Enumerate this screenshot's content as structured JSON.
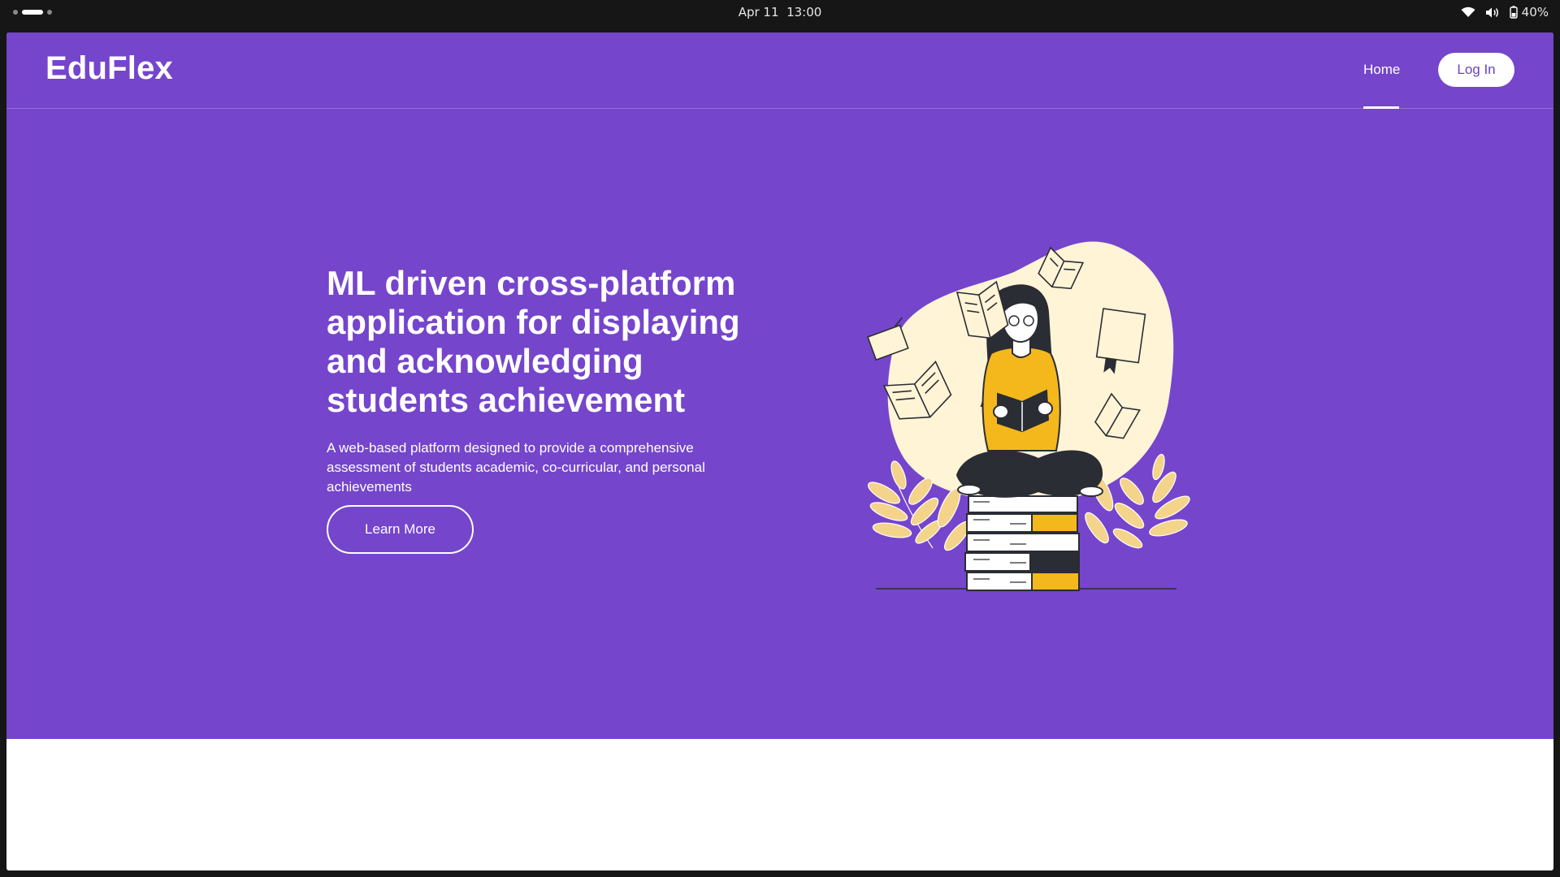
{
  "os_bar": {
    "date": "Apr 11",
    "time": "13:00",
    "battery": "40%",
    "icons": [
      "wifi-icon",
      "volume-icon",
      "battery-icon"
    ]
  },
  "navbar": {
    "brand": "EduFlex",
    "home_label": "Home",
    "login_label": "Log In"
  },
  "hero": {
    "title": "ML driven cross-platform application for displaying and acknowledging students achievement",
    "description": "A web-based platform designed to provide a comprehensive assessment of students academic, co-curricular, and personal achievements",
    "cta_label": "Learn More",
    "illustration": "girl-reading-on-books-illustration"
  },
  "colors": {
    "hero_background": "#7545cc",
    "accent_yellow": "#f5b81c",
    "blob": "#fff4d6",
    "dark": "#2a2d33"
  }
}
